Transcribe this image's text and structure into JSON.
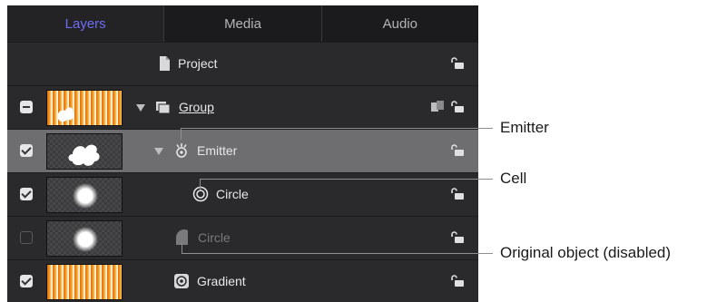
{
  "tabs": [
    {
      "label": "Layers",
      "active": true
    },
    {
      "label": "Media",
      "active": false
    },
    {
      "label": "Audio",
      "active": false
    }
  ],
  "layers": {
    "project": {
      "label": "Project",
      "icon": "document-icon"
    },
    "group": {
      "label": "Group",
      "icon": "group-icon",
      "checkbox": "mixed",
      "thumbnail": "orange-gradient-with-white-shape"
    },
    "emitter": {
      "label": "Emitter",
      "icon": "emitter-icon",
      "checkbox": "checked",
      "selected": true,
      "thumbnail": "white-cloud-shape"
    },
    "cell": {
      "label": "Circle",
      "icon": "particle-cell-icon",
      "checkbox": "checked",
      "thumbnail": "white-blurred-dot"
    },
    "original": {
      "label": "Circle",
      "icon": "shape-icon",
      "checkbox": "unchecked",
      "disabled": true,
      "thumbnail": "white-blurred-dot"
    },
    "gradient": {
      "label": "Gradient",
      "icon": "generator-icon",
      "checkbox": "checked",
      "thumbnail": "orange-gradient"
    }
  },
  "callouts": {
    "emitter": "Emitter",
    "cell": "Cell",
    "original": "Original object (disabled)"
  },
  "colors": {
    "panel_bg": "#2a2a2c",
    "tab_bar_bg": "#1b1b1d",
    "active_tab": "#6f6ef5",
    "selected_row": "#6e6e70",
    "thumb_gradient_start": "#e5680a"
  }
}
